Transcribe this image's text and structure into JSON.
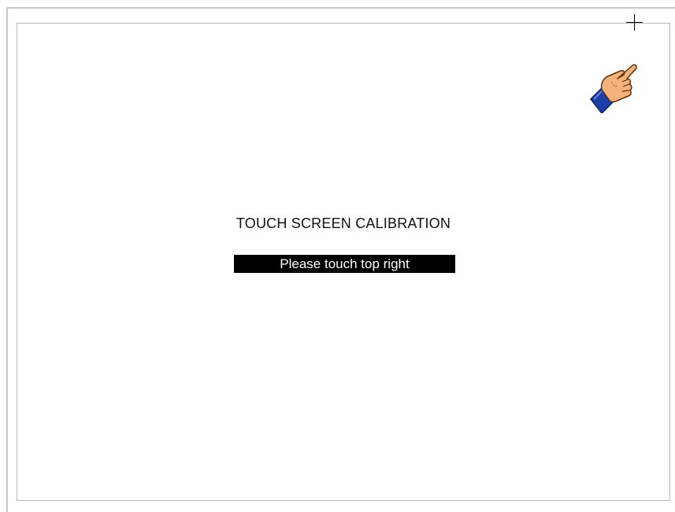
{
  "calibration": {
    "title": "TOUCH SCREEN CALIBRATION",
    "prompt": "Please touch top right",
    "target_corner": "top-right"
  },
  "icons": {
    "hand": "pointing-hand-icon",
    "target": "crosshair-icon"
  },
  "colors": {
    "background": "#ffffff",
    "frame": "#b8b8b8",
    "prompt_bg": "#000000",
    "prompt_text": "#ffffff",
    "hand_skin": "#f4b27a",
    "sleeve": "#1f3fa8"
  }
}
